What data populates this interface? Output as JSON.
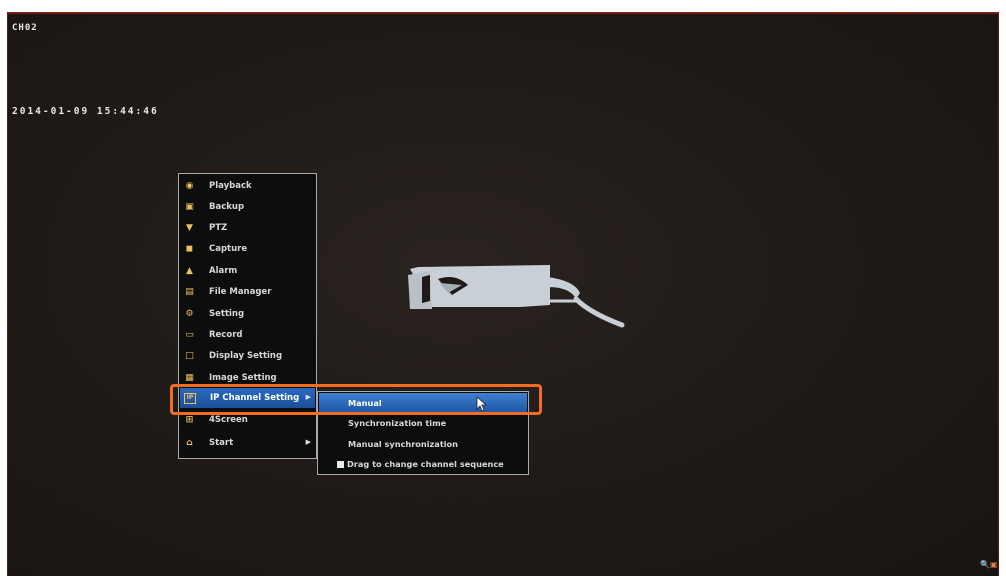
{
  "osd": {
    "channel": "CH02",
    "datetime": "2014-01-09 15:44:46"
  },
  "main_menu": {
    "items": [
      {
        "label": "Playback",
        "icon": "playback-icon"
      },
      {
        "label": "Backup",
        "icon": "backup-icon"
      },
      {
        "label": "PTZ",
        "icon": "ptz-icon"
      },
      {
        "label": "Capture",
        "icon": "capture-icon"
      },
      {
        "label": "Alarm",
        "icon": "alarm-icon"
      },
      {
        "label": "File Manager",
        "icon": "file-manager-icon"
      },
      {
        "label": "Setting",
        "icon": "setting-icon"
      },
      {
        "label": "Record",
        "icon": "record-icon"
      },
      {
        "label": "Display Setting",
        "icon": "display-setting-icon"
      },
      {
        "label": "Image Setting",
        "icon": "image-setting-icon"
      },
      {
        "label": "IP Channel Setting",
        "icon": "ip-channel-icon",
        "active": true,
        "has_submenu": true
      },
      {
        "label": "4Screen",
        "icon": "four-screen-icon"
      },
      {
        "label": "Start",
        "icon": "start-icon",
        "has_submenu": true
      }
    ]
  },
  "sub_menu": {
    "items": [
      {
        "label": "Manual",
        "selected": true
      },
      {
        "label": "Synchronization time"
      },
      {
        "label": "Manual synchronization"
      },
      {
        "label": "Drag to change channel sequence",
        "checkbox": true
      }
    ]
  },
  "colors": {
    "highlight_outline": "#f26d21",
    "menu_active": "#2a6bc0",
    "monitor_border": "#7a1d12"
  }
}
